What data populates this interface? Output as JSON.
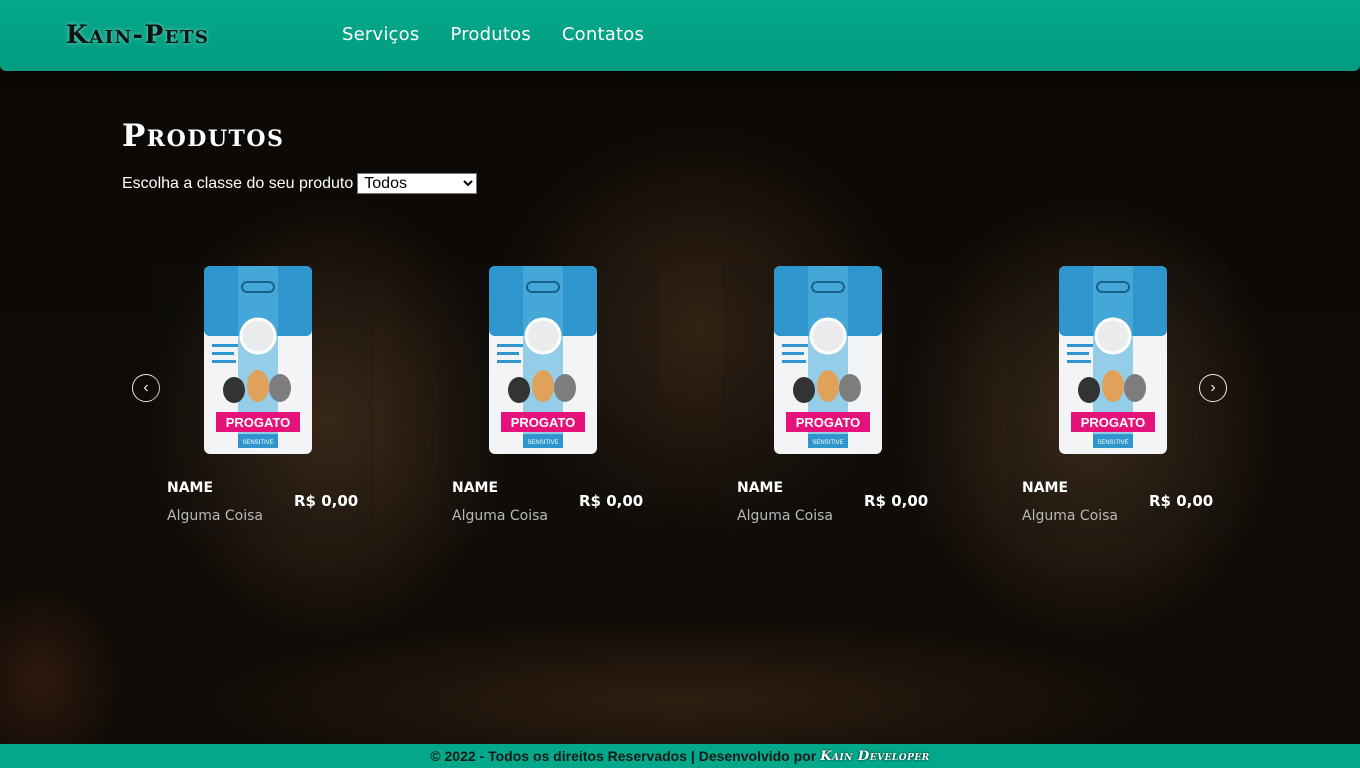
{
  "header": {
    "logo": "Kain-Pets",
    "nav": [
      "Serviços",
      "Produtos",
      "Contatos"
    ]
  },
  "main": {
    "title": "Produtos",
    "filter_label": "Escolha a classe do seu produto",
    "filter_selected": "Todos"
  },
  "products": [
    {
      "name": "NAME",
      "description": "Alguma Coisa",
      "price": "R$ 0,00",
      "brand": "PROGATO",
      "variant": "SENSITIVE"
    },
    {
      "name": "NAME",
      "description": "Alguma Coisa",
      "price": "R$ 0,00",
      "brand": "PROGATO",
      "variant": "SENSITIVE"
    },
    {
      "name": "NAME",
      "description": "Alguma Coisa",
      "price": "R$ 0,00",
      "brand": "PROGATO",
      "variant": "SENSITIVE"
    },
    {
      "name": "NAME",
      "description": "Alguma Coisa",
      "price": "R$ 0,00",
      "brand": "PROGATO",
      "variant": "SENSITIVE"
    }
  ],
  "carousel": {
    "prev_icon": "‹",
    "next_icon": "›"
  },
  "footer": {
    "text": "© 2022 - Todos os direitos Reservados | Desenvolvido por",
    "developer": "Kain Developer"
  },
  "colors": {
    "header_bg": "#05a88a",
    "footer_bg": "#03a88a",
    "package_blue": "#2e96cc",
    "brand_pink": "#e4127a"
  },
  "icons": [
    "arrow-left-icon",
    "arrow-right-icon"
  ]
}
